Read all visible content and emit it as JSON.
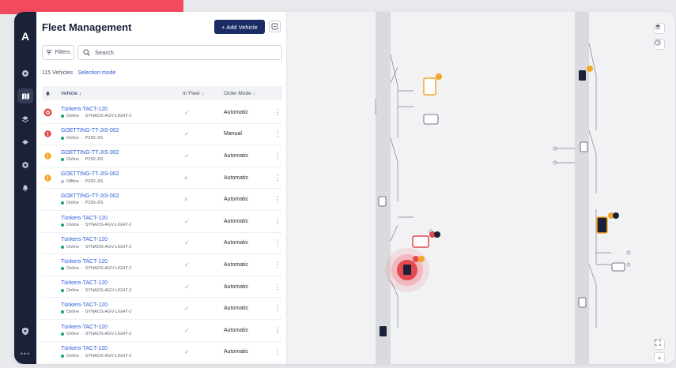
{
  "app": {
    "title": "Fleet Management",
    "logo": "A"
  },
  "header": {
    "add_label": "+ Add Vehicle"
  },
  "filters": {
    "label": "Filters",
    "search_placeholder": "Search"
  },
  "summary": {
    "count": "115 Vehicles",
    "selection_mode": "Selection mode"
  },
  "columns": {
    "vehicle": "Vehicle ↓",
    "in_fleet": "In Fleet ↓",
    "order_mode": "Order Mode ↓"
  },
  "rows": [
    {
      "name": "Tünkers-TACT-120",
      "status": "Online",
      "model": "SYNAOS-AGV-LIGHT-2",
      "alert": "red-ring",
      "fleet": "✓",
      "order": "Automatic"
    },
    {
      "name": "GOETTING-TT-JIS-002",
      "status": "Online",
      "model": "P250-JIS",
      "alert": "red",
      "fleet": "✓",
      "order": "Manual"
    },
    {
      "name": "GOETTING-TT-JIS-002",
      "status": "Online",
      "model": "P250-JIS",
      "alert": "orange",
      "fleet": "✓",
      "order": "Automatic"
    },
    {
      "name": "GOETTING-TT-JIS-002",
      "status": "Offline",
      "model": "P250-JIS",
      "alert": "orange",
      "fleet": "×",
      "order": "Automatic"
    },
    {
      "name": "GOETTING-TT-JIS-002",
      "status": "Online",
      "model": "P250-JIS",
      "alert": "",
      "fleet": "×",
      "order": "Automatic"
    },
    {
      "name": "Tünkers-TACT-120",
      "status": "Online",
      "model": "SYNAOS-AGV-LIGHT-2",
      "alert": "",
      "fleet": "✓",
      "order": "Automatic"
    },
    {
      "name": "Tünkers-TACT-120",
      "status": "Online",
      "model": "SYNAOS-AGV-LIGHT-2",
      "alert": "",
      "fleet": "✓",
      "order": "Automatic"
    },
    {
      "name": "Tünkers-TACT-120",
      "status": "Online",
      "model": "SYNAOS-AGV-LIGHT-2",
      "alert": "",
      "fleet": "✓",
      "order": "Automatic"
    },
    {
      "name": "Tünkers-TACT-120",
      "status": "Online",
      "model": "SYNAOS-AGV-LIGHT-2",
      "alert": "",
      "fleet": "✓",
      "order": "Automatic"
    },
    {
      "name": "Tünkers-TACT-120",
      "status": "Online",
      "model": "SYNAOS-AGV-LIGHT-2",
      "alert": "",
      "fleet": "✓",
      "order": "Automatic"
    },
    {
      "name": "Tünkers-TACT-120",
      "status": "Online",
      "model": "SYNAOS-AGV-LIGHT-2",
      "alert": "",
      "fleet": "✓",
      "order": "Automatic"
    },
    {
      "name": "Tünkers-TACT-120",
      "status": "Online",
      "model": "SYNAOS-AGV-LIGHT-2",
      "alert": "",
      "fleet": "✓",
      "order": "Automatic"
    }
  ],
  "colors": {
    "accent": "#f24a5e",
    "nav_bg": "#1b2138",
    "primary_btn": "#1b2b66",
    "link": "#2b5bd7",
    "online": "#1aa56b",
    "offline": "#b4b8c2",
    "alert_red": "#e5484d",
    "alert_orange": "#f5a524"
  },
  "icons": {
    "nav": [
      "dashboard-icon",
      "map-icon",
      "layers-icon",
      "stack-icon",
      "settings-icon",
      "bell-icon"
    ],
    "bottom": [
      "shield-icon",
      "more-icon"
    ],
    "map_controls": [
      "layers-icon",
      "clock-icon",
      "fullscreen-icon",
      "zoom-in-icon"
    ]
  }
}
